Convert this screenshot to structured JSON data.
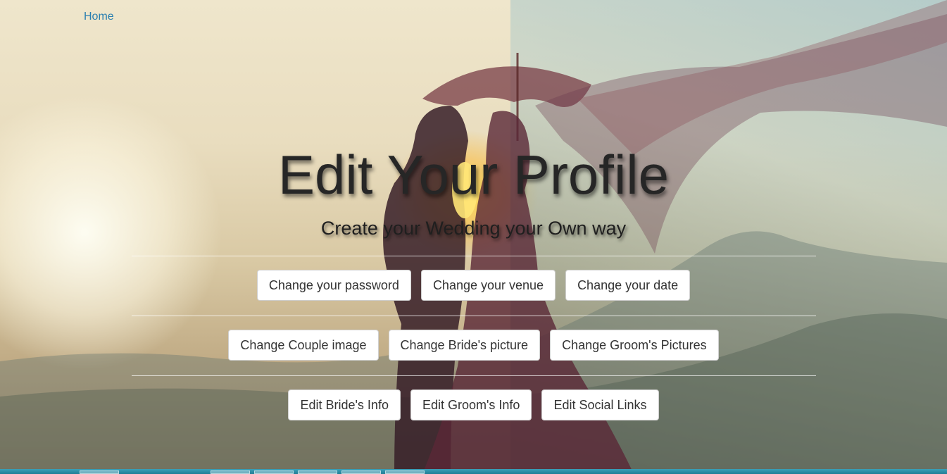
{
  "nav": {
    "home_label": "Home"
  },
  "hero": {
    "title": "Edit Your Profile",
    "subtitle": "Create your Wedding your Own way"
  },
  "actions": {
    "row1": {
      "change_password": "Change your password",
      "change_venue": "Change your venue",
      "change_date": "Change your date"
    },
    "row2": {
      "change_couple_image": "Change Couple image",
      "change_bride_picture": "Change Bride's picture",
      "change_groom_pictures": "Change Groom's Pictures"
    },
    "row3": {
      "edit_bride_info": "Edit Bride's Info",
      "edit_groom_info": "Edit Groom's Info",
      "edit_social_links": "Edit Social Links"
    }
  },
  "colors": {
    "link": "#2a7fb0",
    "title_text": "#262626",
    "button_bg": "#ffffff",
    "button_border": "#cfcfcf",
    "taskbar": "#2a8ea6"
  }
}
